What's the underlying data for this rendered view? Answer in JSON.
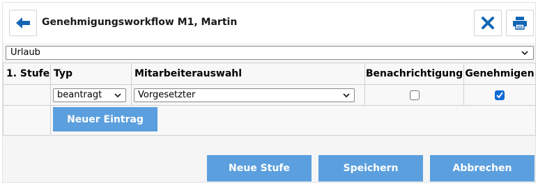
{
  "header": {
    "title": "Genehmigungsworkflow M1, Martin",
    "back_icon": "arrow-left-icon",
    "close_icon": "close-x-icon",
    "print_icon": "printer-icon"
  },
  "category": {
    "selected": "Urlaub"
  },
  "table": {
    "headers": [
      "1. Stufe",
      "Typ",
      "Mitarbeiterauswahl",
      "Benachrichtigung",
      "Genehmigen"
    ],
    "rows": [
      {
        "typ": "beantragt",
        "mitarbeiter": "Vorgesetzter",
        "benachrichtigung": false,
        "genehmigen": true
      }
    ]
  },
  "actions": {
    "new_entry": "Neuer Eintrag",
    "new_stage": "Neue Stufe",
    "save": "Speichern",
    "cancel": "Abbrechen"
  },
  "colors": {
    "accent": "#5b9fde",
    "icon": "#1366b4",
    "checkbox": "#0a69d6"
  }
}
